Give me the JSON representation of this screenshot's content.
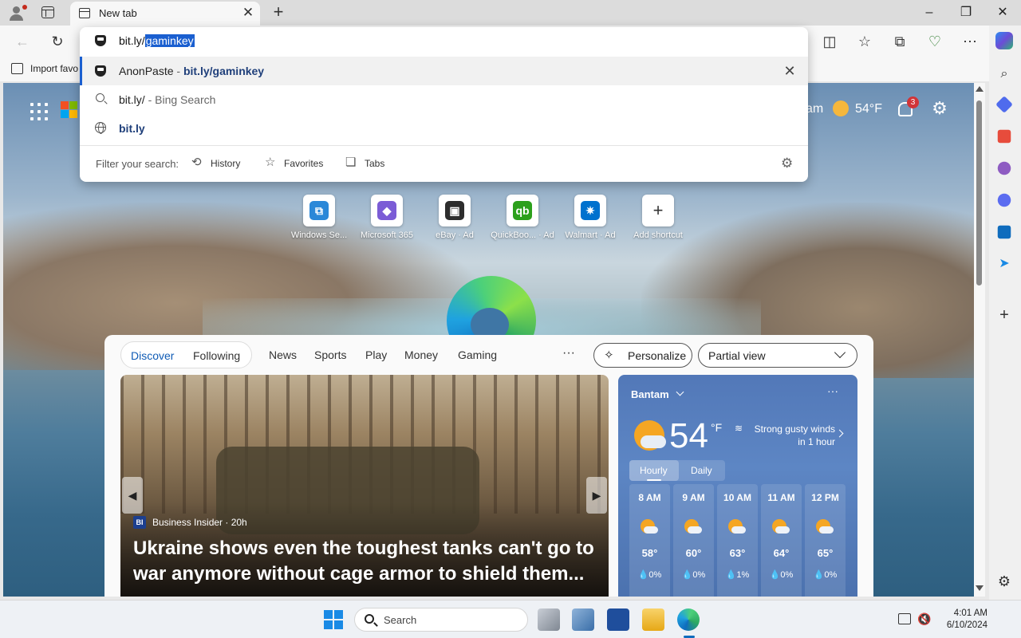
{
  "window": {
    "tab_title": "New tab",
    "controls": {
      "minimize": "–",
      "restore": "❐",
      "close": "✕"
    }
  },
  "toolbar": {
    "bookmark_import_label": "Import favo"
  },
  "omnibox": {
    "typed_prefix": "bit.ly/",
    "autocomplete_selected": "gaminkey",
    "suggestions": [
      {
        "site": "AnonPaste",
        "separator": " - ",
        "url": "bit.ly/gaminkey"
      },
      {
        "query": "bit.ly/",
        "separator": " - ",
        "provider": "Bing Search"
      },
      {
        "url": "bit.ly"
      }
    ],
    "filter_label": "Filter your search:",
    "filters": [
      "History",
      "Favorites",
      "Tabs"
    ]
  },
  "newtab": {
    "user_partial": "am",
    "temperature": "54°F",
    "notification_count": "3",
    "shortcuts": [
      {
        "label": "Windows Se...",
        "color": "#2b88d8",
        "glyph": "⧉"
      },
      {
        "label": "Microsoft 365",
        "color": "#7b5cd6",
        "glyph": "◆"
      },
      {
        "label": "eBay · Ad",
        "color": "#2d2d2d",
        "glyph": "▣"
      },
      {
        "label": "QuickBoo... · Ad",
        "color": "#2ca01c",
        "glyph": "qb"
      },
      {
        "label": "Walmart · Ad",
        "color": "#0071ce",
        "glyph": "✷"
      },
      {
        "label": "Add shortcut",
        "color": "#ffffff",
        "glyph": "+"
      }
    ]
  },
  "feed": {
    "tabs_primary": [
      "Discover",
      "Following"
    ],
    "tabs": [
      "News",
      "Sports",
      "Play",
      "Money",
      "Gaming"
    ],
    "more": "···",
    "personalize": "Personalize",
    "view_mode": "Partial view",
    "article": {
      "source_badge": "BI",
      "source": "Business Insider · 20h",
      "headline": "Ukraine shows even the toughest tanks can't go to war anymore without cage armor to shield them..."
    },
    "weather": {
      "location": "Bantam",
      "more": "···",
      "temp": "54",
      "unit": "°F",
      "alert": "Strong gusty winds in 1 hour",
      "tab_hourly": "Hourly",
      "tab_daily": "Daily",
      "hours": [
        {
          "time": "8 AM",
          "temp": "58°",
          "precip": "💧0%"
        },
        {
          "time": "9 AM",
          "temp": "60°",
          "precip": "💧0%"
        },
        {
          "time": "10 AM",
          "temp": "63°",
          "precip": "💧1%"
        },
        {
          "time": "11 AM",
          "temp": "64°",
          "precip": "💧0%"
        },
        {
          "time": "12 PM",
          "temp": "65°",
          "precip": "💧0%"
        }
      ]
    }
  },
  "taskbar": {
    "search_placeholder": "Search",
    "time": "4:01 AM",
    "date": "6/10/2024"
  }
}
